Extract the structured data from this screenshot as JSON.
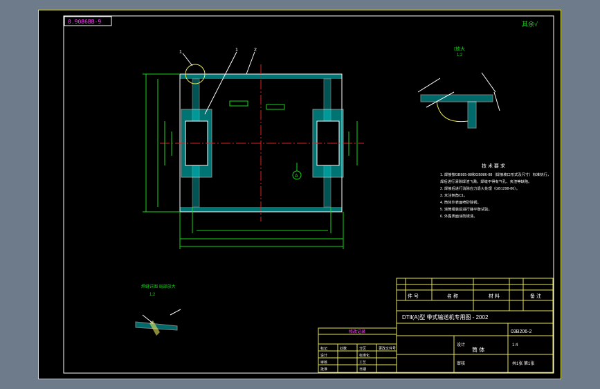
{
  "colors": {
    "background": "#6e7b8b",
    "sheet": "#000000",
    "frame": "#e6e65a",
    "outline": "#ffffff",
    "section": "#00d2d2",
    "centerline": "#e02020",
    "dimension": "#18d818",
    "note": "#ff40ff"
  },
  "labels": {
    "drawing_code_box": "0.9086BB-9",
    "roughness_note": "其余√",
    "detail_view_top": "I放大",
    "detail_scale_top": "1:2",
    "detail_view_bottom": "焊缝详图 局部放大",
    "detail_scale_bottom": "1:2",
    "leader_1": "1",
    "leader_2": "1",
    "leader_3": "2",
    "datum_a": "A"
  },
  "notes": {
    "title": "技 术 要 求",
    "items": [
      "1. 焊接按GB985-88和GB986-88（焊接坡口形式及尺寸）标准执行，",
      "  焊后进行清除焊渣飞溅，焊缝不得有气孔、夹渣等缺陷。",
      "2. 焊接后进行消除应力退火处理（GB1298-86）。",
      "3. 未注倒角C1。",
      "4. 筒体外表面喷砂除锈。",
      "5. 滚筒组装后进行静平衡试验。",
      "6. 外露表面涂防锈漆。"
    ]
  },
  "title_block": {
    "row_labels": [
      "件 号",
      "名 称",
      "材 料",
      "备 注"
    ],
    "company": "DTⅡ(A)型 带式输送机专用图 - 2002",
    "drawing_no": "03B206-2",
    "name": "筒 体",
    "scale": "1:4",
    "sheet": "共1张 第1张",
    "designer": "设计",
    "checker": "审核"
  },
  "revision_table": {
    "header": "修改记录",
    "rows": [
      [
        "标记",
        "处数",
        "分区",
        "更改文件号"
      ],
      [
        "设计",
        "",
        "标准化",
        ""
      ],
      [
        "审核",
        "",
        "工艺",
        ""
      ],
      [
        "批准",
        "",
        "日期",
        ""
      ]
    ]
  }
}
